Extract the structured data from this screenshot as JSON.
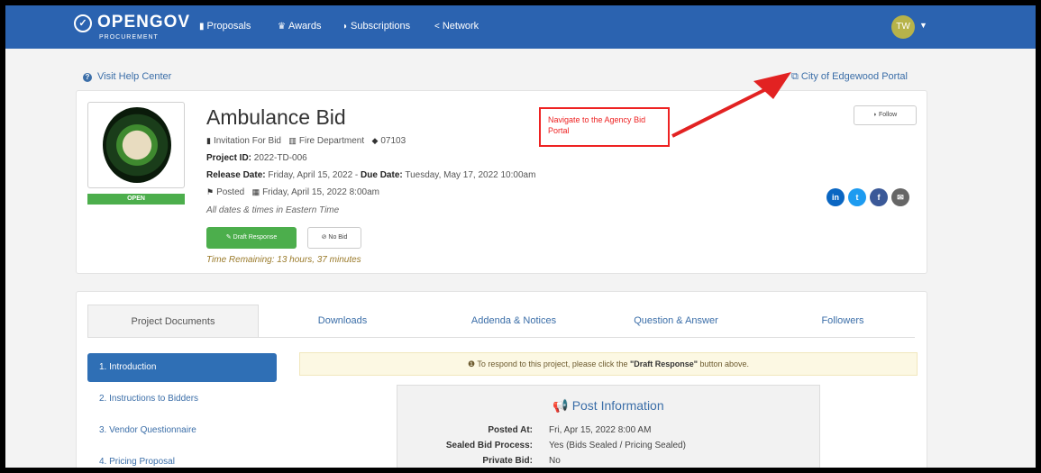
{
  "navbar": {
    "logo_text": "OPENGOV",
    "logo_sub": "PROCUREMENT",
    "items": [
      {
        "label": "Proposals",
        "icon": "document-icon"
      },
      {
        "label": "Awards",
        "icon": "trophy-icon"
      },
      {
        "label": "Subscriptions",
        "icon": "rss-icon"
      },
      {
        "label": "Network",
        "icon": "share-icon"
      }
    ],
    "avatar_initials": "TW",
    "color": "#2b63b0"
  },
  "help": {
    "label": "Visit Help Center"
  },
  "portal": {
    "label": "City of Edgewood Portal"
  },
  "callout": {
    "text": "Navigate to the Agency Bid Portal",
    "color": "#e22222"
  },
  "project": {
    "title": "Ambulance Bid",
    "type": "Invitation For Bid",
    "department": "Fire Department",
    "code": "07103",
    "project_id_label": "Project ID:",
    "project_id": "2022-TD-006",
    "release_label": "Release Date:",
    "release_date": "Friday, April 15, 2022",
    "due_label": "Due Date:",
    "due_date": "Tuesday, May 17, 2022 10:00am",
    "posted_label": "Posted",
    "posted_date": "Friday, April 15, 2022 8:00am",
    "timezone_note": "All dates & times in Eastern Time",
    "status": "OPEN",
    "draft_button": "Draft Response",
    "nobid_button": "No Bid",
    "time_remaining": "Time Remaining: 13 hours, 37 minutes",
    "follow_button": "Follow",
    "social": [
      {
        "icon": "linkedin-icon",
        "glyph": "in",
        "color": "#0a66c2"
      },
      {
        "icon": "twitter-icon",
        "glyph": "t",
        "color": "#1d9bf0"
      },
      {
        "icon": "facebook-icon",
        "glyph": "f",
        "color": "#3b5998"
      },
      {
        "icon": "email-icon",
        "glyph": "✉",
        "color": "#666666"
      }
    ]
  },
  "tabs": [
    "Project Documents",
    "Downloads",
    "Addenda & Notices",
    "Question & Answer",
    "Followers"
  ],
  "sidebar": [
    "1. Introduction",
    "2. Instructions to Bidders",
    "3. Vendor Questionnaire",
    "4. Pricing Proposal"
  ],
  "notice": {
    "prefix": "To respond to this project, please click the ",
    "bold": "\"Draft Response\"",
    "suffix": " button above."
  },
  "post_info": {
    "title": "Post Information",
    "rows": [
      {
        "label": "Posted At:",
        "value": "Fri, Apr 15, 2022 8:00 AM"
      },
      {
        "label": "Sealed Bid Process:",
        "value": "Yes (Bids Sealed / Pricing Sealed)"
      },
      {
        "label": "Private Bid:",
        "value": "No"
      }
    ]
  }
}
